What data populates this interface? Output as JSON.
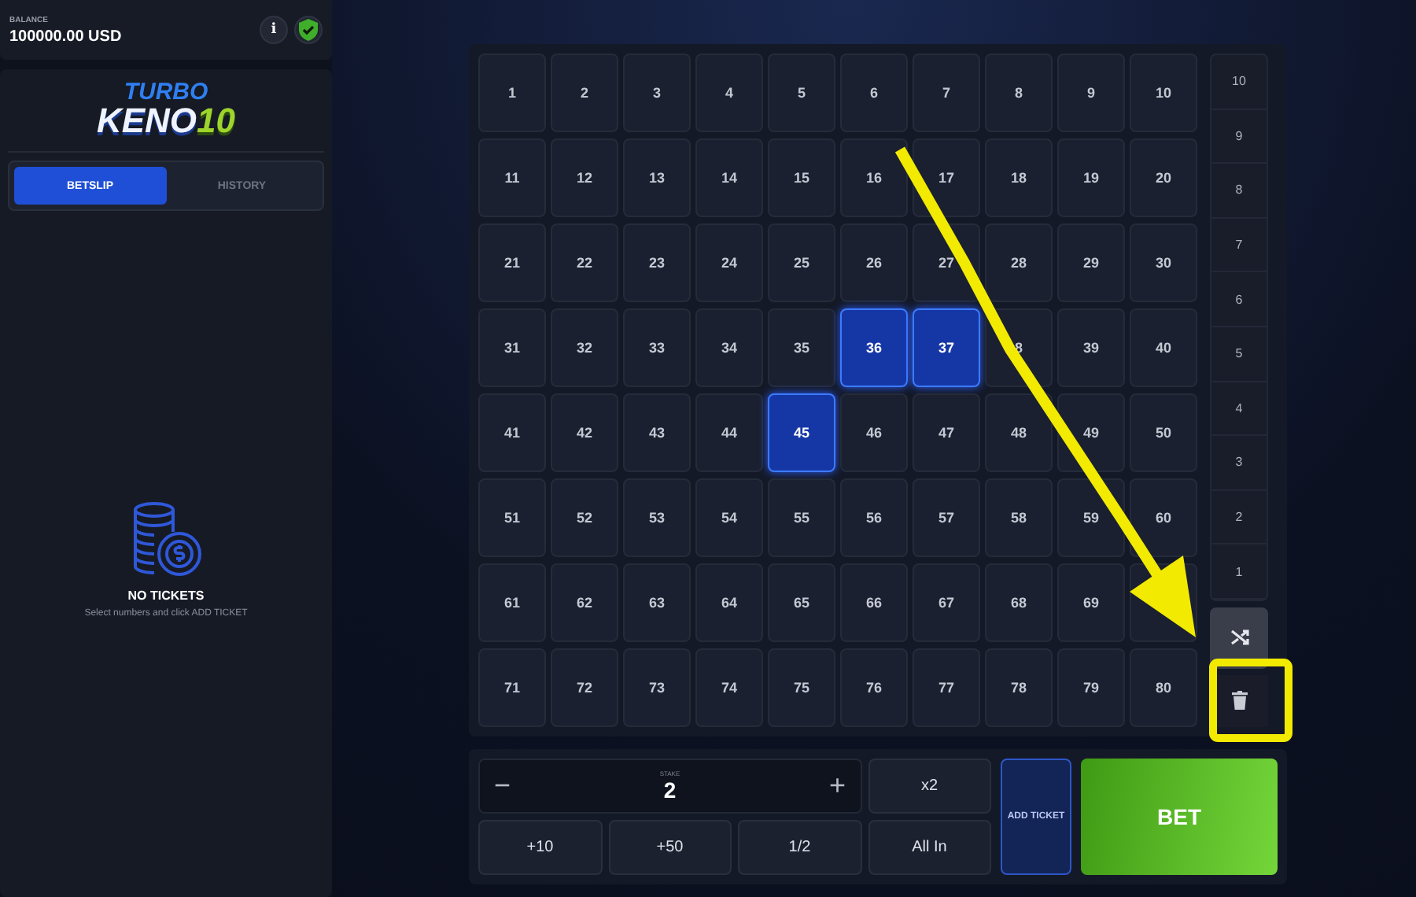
{
  "balance": {
    "label": "BALANCE",
    "amount": "100000.00 USD",
    "info": "i"
  },
  "logo": {
    "top": "TURBO",
    "main": "KENO",
    "number": "10"
  },
  "tabs": [
    {
      "label": "BETSLIP",
      "selected": true
    },
    {
      "label": "HISTORY",
      "selected": false
    }
  ],
  "empty_state": {
    "title": "NO TICKETS",
    "hint": "Select numbers and click ADD TICKET"
  },
  "cells": [
    {
      "label": "1",
      "selected": false
    },
    {
      "label": "2",
      "selected": false
    },
    {
      "label": "3",
      "selected": false
    },
    {
      "label": "4",
      "selected": false
    },
    {
      "label": "5",
      "selected": false
    },
    {
      "label": "6",
      "selected": false
    },
    {
      "label": "7",
      "selected": false
    },
    {
      "label": "8",
      "selected": false
    },
    {
      "label": "9",
      "selected": false
    },
    {
      "label": "10",
      "selected": false
    },
    {
      "label": "11",
      "selected": false
    },
    {
      "label": "12",
      "selected": false
    },
    {
      "label": "13",
      "selected": false
    },
    {
      "label": "14",
      "selected": false
    },
    {
      "label": "15",
      "selected": false
    },
    {
      "label": "16",
      "selected": false
    },
    {
      "label": "17",
      "selected": false
    },
    {
      "label": "18",
      "selected": false
    },
    {
      "label": "19",
      "selected": false
    },
    {
      "label": "20",
      "selected": false
    },
    {
      "label": "21",
      "selected": false
    },
    {
      "label": "22",
      "selected": false
    },
    {
      "label": "23",
      "selected": false
    },
    {
      "label": "24",
      "selected": false
    },
    {
      "label": "25",
      "selected": false
    },
    {
      "label": "26",
      "selected": false
    },
    {
      "label": "27",
      "selected": false
    },
    {
      "label": "28",
      "selected": false
    },
    {
      "label": "29",
      "selected": false
    },
    {
      "label": "30",
      "selected": false
    },
    {
      "label": "31",
      "selected": false
    },
    {
      "label": "32",
      "selected": false
    },
    {
      "label": "33",
      "selected": false
    },
    {
      "label": "34",
      "selected": false
    },
    {
      "label": "35",
      "selected": false
    },
    {
      "label": "36",
      "selected": true
    },
    {
      "label": "37",
      "selected": true
    },
    {
      "label": "8",
      "selected": false
    },
    {
      "label": "39",
      "selected": false
    },
    {
      "label": "40",
      "selected": false
    },
    {
      "label": "41",
      "selected": false
    },
    {
      "label": "42",
      "selected": false
    },
    {
      "label": "43",
      "selected": false
    },
    {
      "label": "44",
      "selected": false
    },
    {
      "label": "45",
      "selected": true
    },
    {
      "label": "46",
      "selected": false
    },
    {
      "label": "47",
      "selected": false
    },
    {
      "label": "48",
      "selected": false
    },
    {
      "label": "49",
      "selected": false
    },
    {
      "label": "50",
      "selected": false
    },
    {
      "label": "51",
      "selected": false
    },
    {
      "label": "52",
      "selected": false
    },
    {
      "label": "53",
      "selected": false
    },
    {
      "label": "54",
      "selected": false
    },
    {
      "label": "55",
      "selected": false
    },
    {
      "label": "56",
      "selected": false
    },
    {
      "label": "57",
      "selected": false
    },
    {
      "label": "58",
      "selected": false
    },
    {
      "label": "59",
      "selected": false
    },
    {
      "label": "60",
      "selected": false
    },
    {
      "label": "61",
      "selected": false
    },
    {
      "label": "62",
      "selected": false
    },
    {
      "label": "63",
      "selected": false
    },
    {
      "label": "64",
      "selected": false
    },
    {
      "label": "65",
      "selected": false
    },
    {
      "label": "66",
      "selected": false
    },
    {
      "label": "67",
      "selected": false
    },
    {
      "label": "68",
      "selected": false
    },
    {
      "label": "69",
      "selected": false
    },
    {
      "selected": false
    },
    {
      "label": "71",
      "selected": false
    },
    {
      "label": "72",
      "selected": false
    },
    {
      "label": "73",
      "selected": false
    },
    {
      "label": "74",
      "selected": false
    },
    {
      "label": "75",
      "selected": false
    },
    {
      "label": "76",
      "selected": false
    },
    {
      "label": "77",
      "selected": false
    },
    {
      "label": "78",
      "selected": false
    },
    {
      "label": "79",
      "selected": false
    },
    {
      "label": "80",
      "selected": false
    }
  ],
  "hits_column": [
    "10",
    "9",
    "8",
    "7",
    "6",
    "5",
    "4",
    "3",
    "2",
    "1"
  ],
  "stake": {
    "label": "STAKE",
    "value": "2",
    "minus": "−",
    "plus": "+"
  },
  "quick_buttons": [
    "x2",
    "+10",
    "+50",
    "1/2",
    "All In"
  ],
  "add_ticket": "ADD TICKET",
  "bet": "BET"
}
